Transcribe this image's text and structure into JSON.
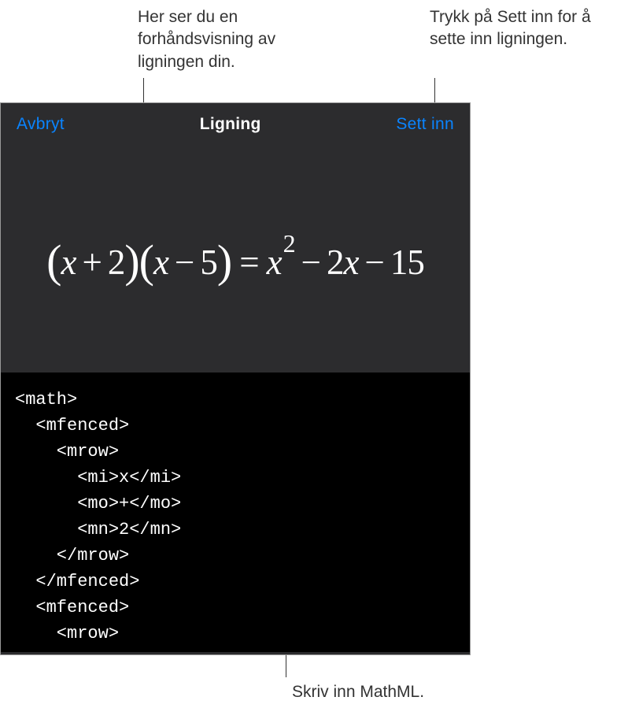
{
  "callouts": {
    "preview": "Her ser du en forhåndsvisning av ligningen din.",
    "insert": "Trykk på Sett inn for å sette inn ligningen.",
    "mathml": "Skriv inn MathML."
  },
  "header": {
    "cancel": "Avbryt",
    "title": "Ligning",
    "insert": "Sett inn"
  },
  "equation_preview": "(x + 2)(x − 5) = x² − 2x − 15",
  "code": "<math>\n  <mfenced>\n    <mrow>\n      <mi>x</mi>\n      <mo>+</mo>\n      <mn>2</mn>\n    </mrow>\n  </mfenced>\n  <mfenced>\n    <mrow>"
}
